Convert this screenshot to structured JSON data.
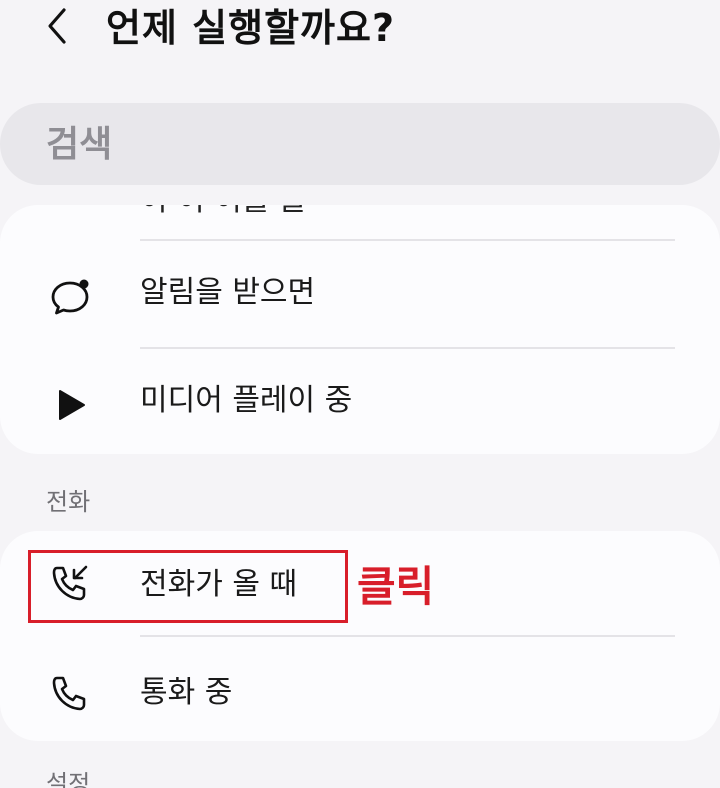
{
  "header": {
    "title": "언제 실행할까요?"
  },
  "search": {
    "placeholder": "검색"
  },
  "top_card": {
    "cut_item": "이 이 이를 들",
    "items": [
      {
        "label": "알림을 받으면",
        "icon": "chat-bubble-icon"
      },
      {
        "label": "미디어 플레이 중",
        "icon": "play-icon"
      }
    ]
  },
  "section": {
    "label": "전화"
  },
  "phone_card": {
    "items": [
      {
        "label": "전화가 올 때",
        "icon": "incoming-call-icon"
      },
      {
        "label": "통화 중",
        "icon": "phone-icon"
      }
    ]
  },
  "next_section": {
    "label": "설정"
  },
  "annotation": {
    "text": "클릭",
    "color": "#d81e2a"
  }
}
